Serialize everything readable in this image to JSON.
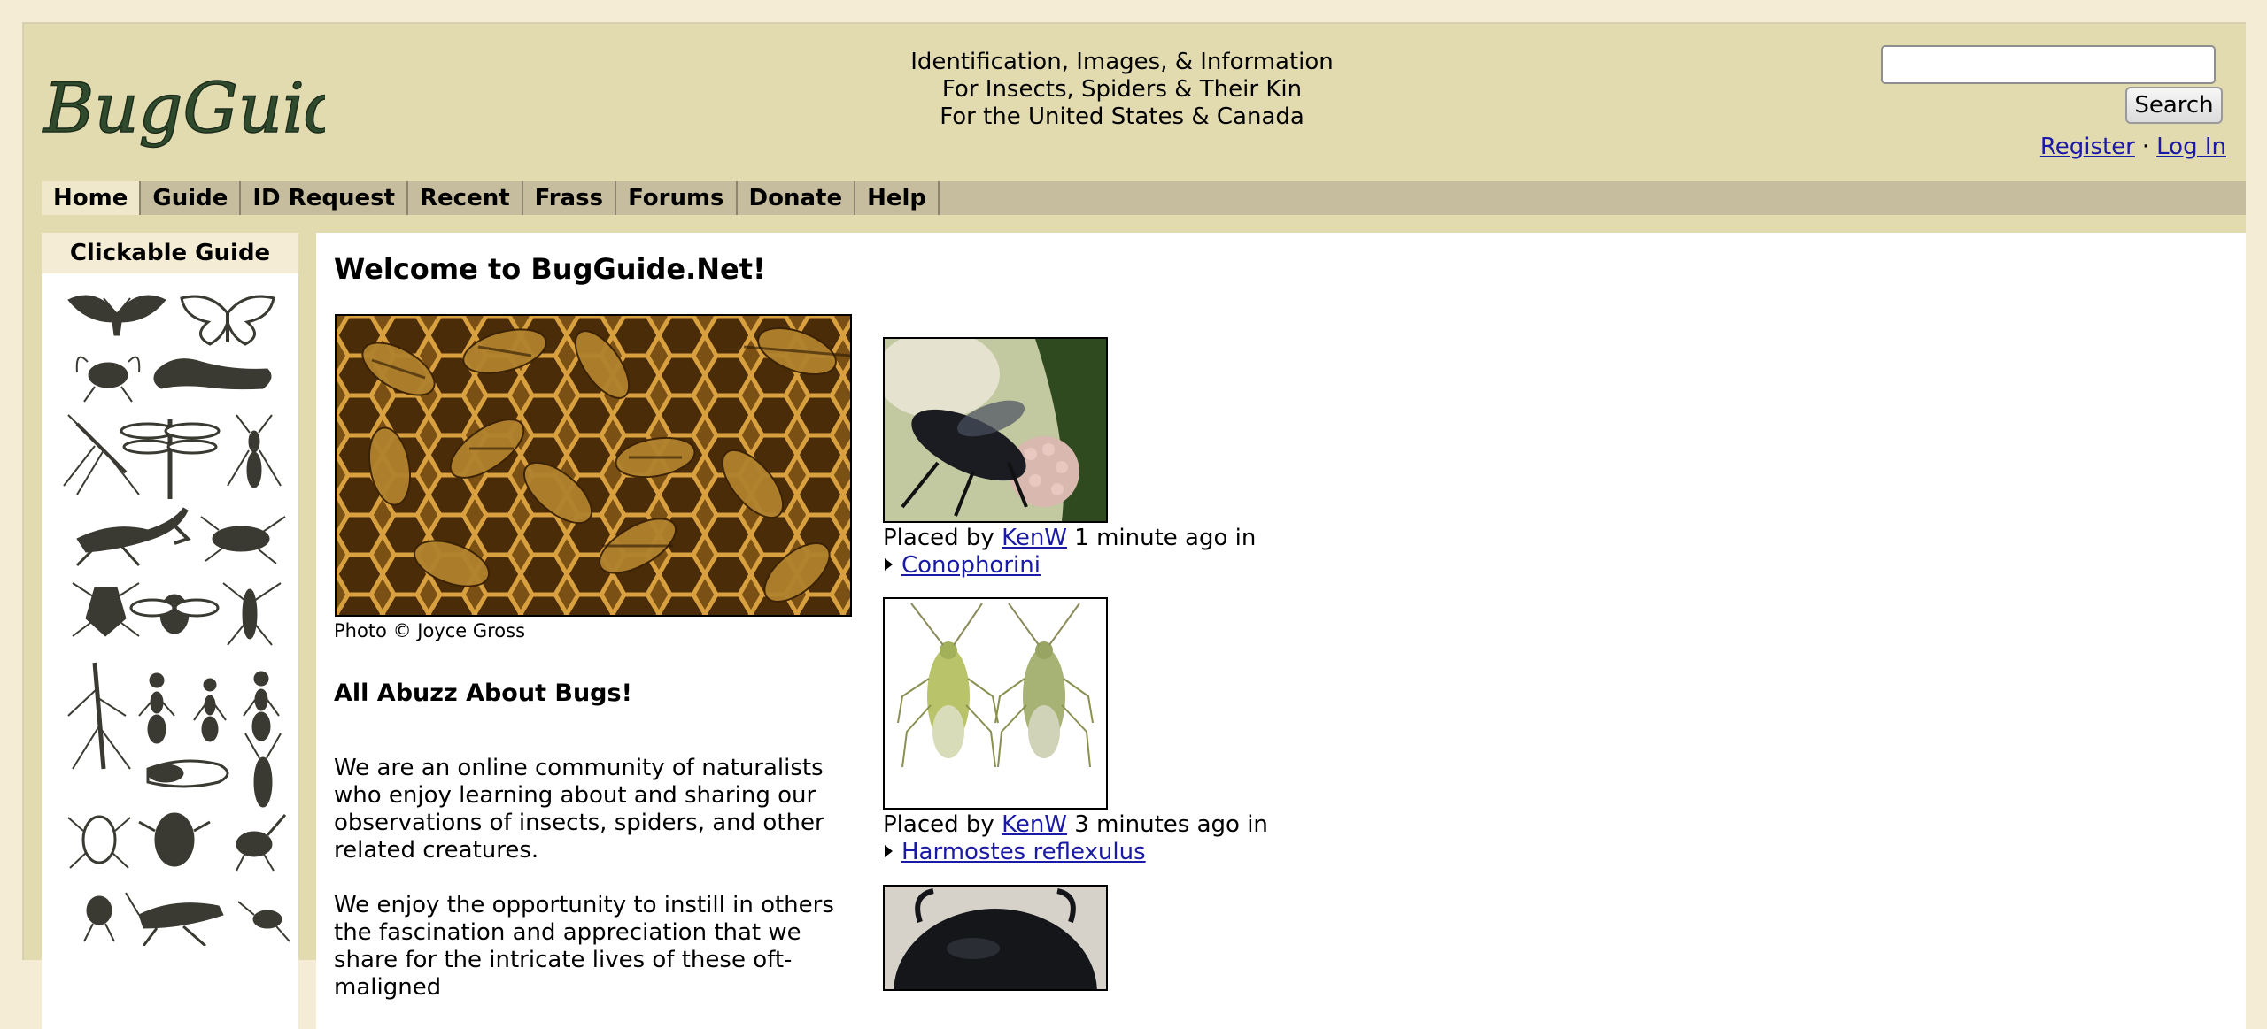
{
  "header": {
    "logo_text": "BugGuide",
    "tagline": [
      "Identification, Images, & Information",
      "For Insects, Spiders & Their Kin",
      "For the United States & Canada"
    ],
    "search": {
      "value": "",
      "button_label": "Search"
    },
    "register_label": "Register",
    "separator": "·",
    "login_label": "Log In"
  },
  "nav": {
    "items": [
      {
        "label": "Home",
        "active": true
      },
      {
        "label": "Guide"
      },
      {
        "label": "ID Request"
      },
      {
        "label": "Recent"
      },
      {
        "label": "Frass"
      },
      {
        "label": "Forums"
      },
      {
        "label": "Donate"
      },
      {
        "label": "Help"
      }
    ]
  },
  "sidebar": {
    "title": "Clickable Guide",
    "icons": [
      "moth-icon",
      "butterfly-icon",
      "fly-icon",
      "caterpillar-icon",
      "mosquito-icon",
      "dragonfly-icon",
      "wasp-icon",
      "mantis-icon",
      "cockroach-icon",
      "stink-bug-icon",
      "bee-icon",
      "assassin-bug-icon",
      "stick-insect-icon",
      "ant-icon",
      "ant-icon",
      "ant-icon",
      "cicada-icon",
      "longhorn-beetle-icon",
      "beetle-icon",
      "scarab-icon",
      "weevil-icon",
      "flea-icon",
      "grasshopper-icon",
      "cricket-icon"
    ]
  },
  "main": {
    "welcome": "Welcome to BugGuide.Net!",
    "hero_caption": "Photo © Joyce Gross",
    "intro_heading": "All Abuzz About Bugs!",
    "intro_p1": "We are an online community of naturalists who enjoy learning about and sharing our observations of insects, spiders, and other related creatures.",
    "intro_p2": "We enjoy the opportunity to instill in others the fascination and appreciation that we share for the intricate lives of these oft-maligned"
  },
  "recent": [
    {
      "placed_prefix": "Placed by",
      "user": "KenW",
      "time": "1 minute ago in",
      "taxon": "Conophorini"
    },
    {
      "placed_prefix": "Placed by",
      "user": "KenW",
      "time": "3 minutes ago in",
      "taxon": "Harmostes reflexulus"
    }
  ]
}
